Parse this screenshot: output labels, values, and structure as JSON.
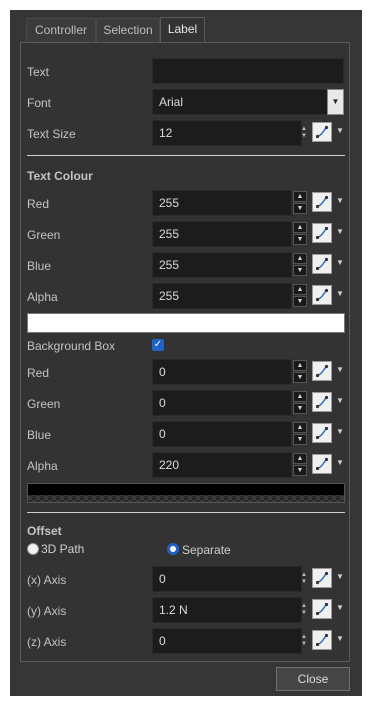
{
  "tabs": [
    {
      "label": "Controller"
    },
    {
      "label": "Selection"
    },
    {
      "label": "Label",
      "active": true
    }
  ],
  "fields": {
    "text": {
      "label": "Text",
      "value": ""
    },
    "font": {
      "label": "Font",
      "value": "Arial"
    },
    "text_size": {
      "label": "Text Size",
      "value": "12"
    }
  },
  "text_colour": {
    "title": "Text Colour",
    "red": {
      "label": "Red",
      "value": "255"
    },
    "green": {
      "label": "Green",
      "value": "255"
    },
    "blue": {
      "label": "Blue",
      "value": "255"
    },
    "alpha": {
      "label": "Alpha",
      "value": "255"
    },
    "swatch_color": "#ffffff"
  },
  "background_box": {
    "label": "Background Box",
    "checked": true,
    "red": {
      "label": "Red",
      "value": "0"
    },
    "green": {
      "label": "Green",
      "value": "0"
    },
    "blue": {
      "label": "Blue",
      "value": "0"
    },
    "alpha": {
      "label": "Alpha",
      "value": "220"
    },
    "swatch_color": "#000000"
  },
  "offset": {
    "title": "Offset",
    "mode_3d_path": {
      "label": "3D Path",
      "selected": false
    },
    "mode_separate": {
      "label": "Separate",
      "selected": true
    },
    "x": {
      "label": "(x) Axis",
      "value": "0"
    },
    "y": {
      "label": "(y) Axis",
      "value": "1.2 N"
    },
    "z": {
      "label": "(z) Axis",
      "value": "0"
    }
  },
  "buttons": {
    "close": "Close"
  },
  "colors": {
    "accent": "#1e64c8",
    "panel_bg": "#333333",
    "field_bg": "#1c1c1c"
  }
}
